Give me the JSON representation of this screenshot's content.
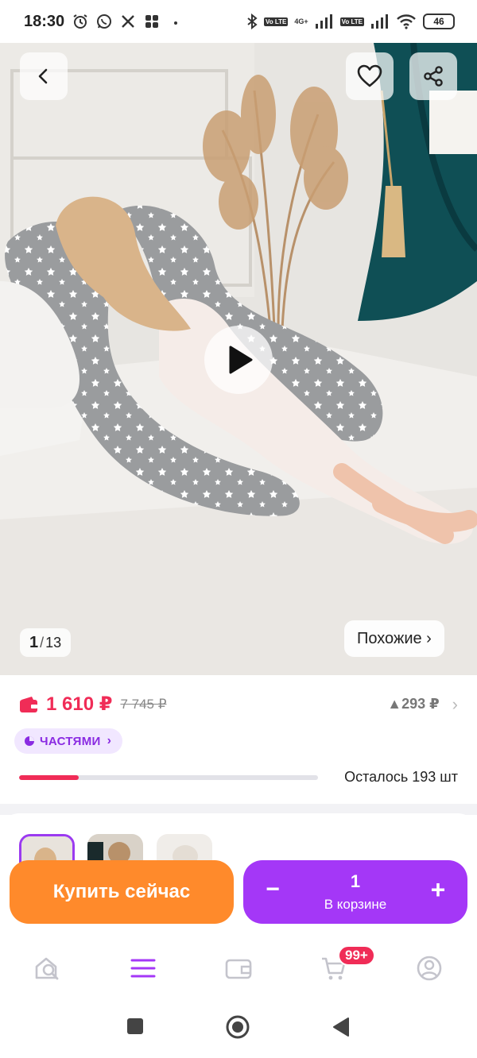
{
  "status_bar": {
    "time": "18:30",
    "left_icons": [
      "alarm-icon",
      "whatsapp-icon",
      "x-icon",
      "app-grid-icon",
      "dot-icon"
    ],
    "network_label": "4G+",
    "lte_label": "Vo LTE",
    "battery": "46"
  },
  "hero": {
    "counter_current": "1",
    "counter_sep": "/",
    "counter_total": "13",
    "similar_label": "Похожие ›"
  },
  "product": {
    "price": "1 610 ₽",
    "old_price": "7 745 ₽",
    "bonus": "▲293 ₽",
    "parts_label": "ЧАСТЯМИ",
    "stock_text": "Осталось 193 шт",
    "stock_fraction": 0.2
  },
  "actions": {
    "buy_now": "Купить сейчас",
    "cart_qty": "1",
    "cart_label": "В корзине",
    "minus": "−",
    "plus": "+"
  },
  "bottom_nav": {
    "items": [
      "home-search-icon",
      "catalog-menu-icon",
      "wallet-icon",
      "cart-icon",
      "profile-icon"
    ],
    "cart_badge": "99+"
  },
  "colors": {
    "accent_purple": "#a437f7",
    "price_red": "#f02c57",
    "buy_orange": "#ff8a2b"
  }
}
